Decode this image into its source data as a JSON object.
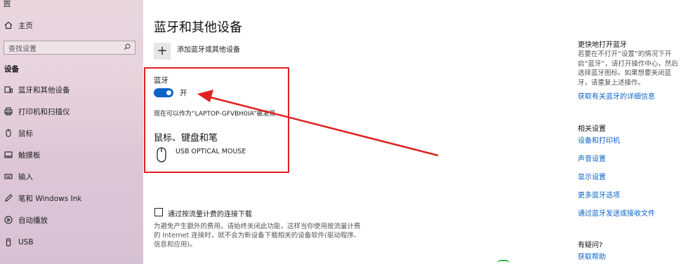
{
  "nav": {
    "top_glyph": "置",
    "home": "主页",
    "search_placeholder": "查找设置",
    "section": "设备",
    "items": [
      {
        "label": "蓝牙和其他设备",
        "icon": "devices-icon"
      },
      {
        "label": "打印机和扫描仪",
        "icon": "printer-icon"
      },
      {
        "label": "鼠标",
        "icon": "mouse-icon"
      },
      {
        "label": "触摸板",
        "icon": "touchpad-icon"
      },
      {
        "label": "输入",
        "icon": "keyboard-icon"
      },
      {
        "label": "笔和 Windows Ink",
        "icon": "pen-icon"
      },
      {
        "label": "自动播放",
        "icon": "autoplay-icon"
      },
      {
        "label": "USB",
        "icon": "usb-icon"
      }
    ]
  },
  "main": {
    "title": "蓝牙和其他设备",
    "add_device": "添加蓝牙或其他设备",
    "bluetooth_label": "蓝牙",
    "bluetooth_state": "开",
    "discoverable": "现在可以作为“LAPTOP-GFVBH0IA”被发现",
    "mouse_section": "鼠标、键盘和笔",
    "mouse_device": "USB OPTICAL MOUSE",
    "metered_label": "通过按流量计费的连接下载",
    "metered_desc": "为避免产生额外的费用，请始终关闭此功能，这样当你使用按流量计费的 Internet 连接时，就不会为新设备下载相关的设备软件(驱动程序、信息和应用)。"
  },
  "right": {
    "quick_heading": "更快地打开蓝牙",
    "quick_desc": "若要在不打开“设置”的情况下开启“蓝牙”，请打开操作中心，然后选择蓝牙图标。如果想要关闭蓝牙，请重复上述操作。",
    "quick_link": "获取有关蓝牙的详细信息",
    "related_heading": "相关设置",
    "related_links": [
      "设备和打印机",
      "声音设置",
      "显示设置",
      "更多蓝牙选项",
      "通过蓝牙发送或接收文件"
    ],
    "help_heading": "有疑问?",
    "help_link": "获取帮助"
  },
  "colors": {
    "accent": "#0a64c8",
    "highlight_box": "#e02020",
    "arrow": "#e02020"
  }
}
